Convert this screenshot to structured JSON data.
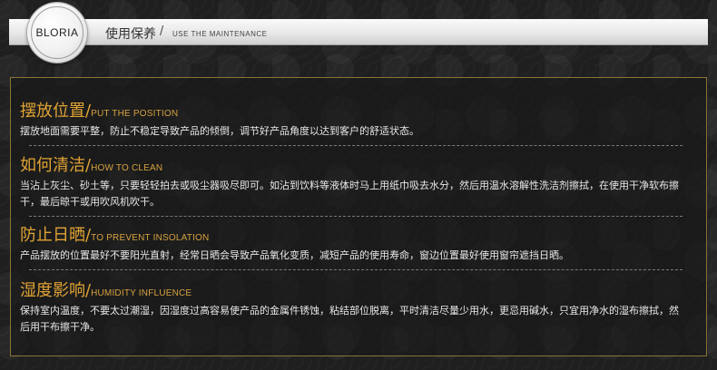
{
  "header": {
    "logo_text": "BLORIA",
    "title": "使用保养",
    "slash": "/",
    "subtitle": "USE THE MAINTENANCE"
  },
  "sections": [
    {
      "title_cn": "摆放位置/",
      "title_en": "PUT THE POSITION",
      "body": "摆放地面需要平整，防止不稳定导致产品的倾倒，调节好产品角度以达到客户的舒适状态。"
    },
    {
      "title_cn": "如何清洁/",
      "title_en": "HOW TO CLEAN",
      "body": "当沾上灰尘、砂土等，只要轻轻拍去或吸尘器吸尽即可。如沾到饮料等液体时马上用纸巾吸去水分，然后用温水溶解性洗洁剂擦拭，在使用干净软布擦干，最后晾干或用吹风机吹干。"
    },
    {
      "title_cn": "防止日晒/",
      "title_en": "TO PREVENT INSOLATION",
      "body": "产品摆放的位置最好不要阳光直射，经常日晒会导致产品氧化变质，减短产品的使用寿命，窗边位置最好使用窗帘遮挡日晒。"
    },
    {
      "title_cn": "湿度影响/",
      "title_en": "HUMIDITY INFLUENCE",
      "body": "保持室内温度，不要太过潮湿，因湿度过高容易使产品的金属件锈蚀，粘结部位脱离，平时清洁尽量少用水，更忌用碱水，只宜用净水的湿布擦拭，然后用干布擦干净。"
    }
  ],
  "colors": {
    "accent_gold": "#e0a334",
    "border_gold": "#8a7436",
    "body_text": "#e8e8e8",
    "background": "#1f1f1f"
  }
}
